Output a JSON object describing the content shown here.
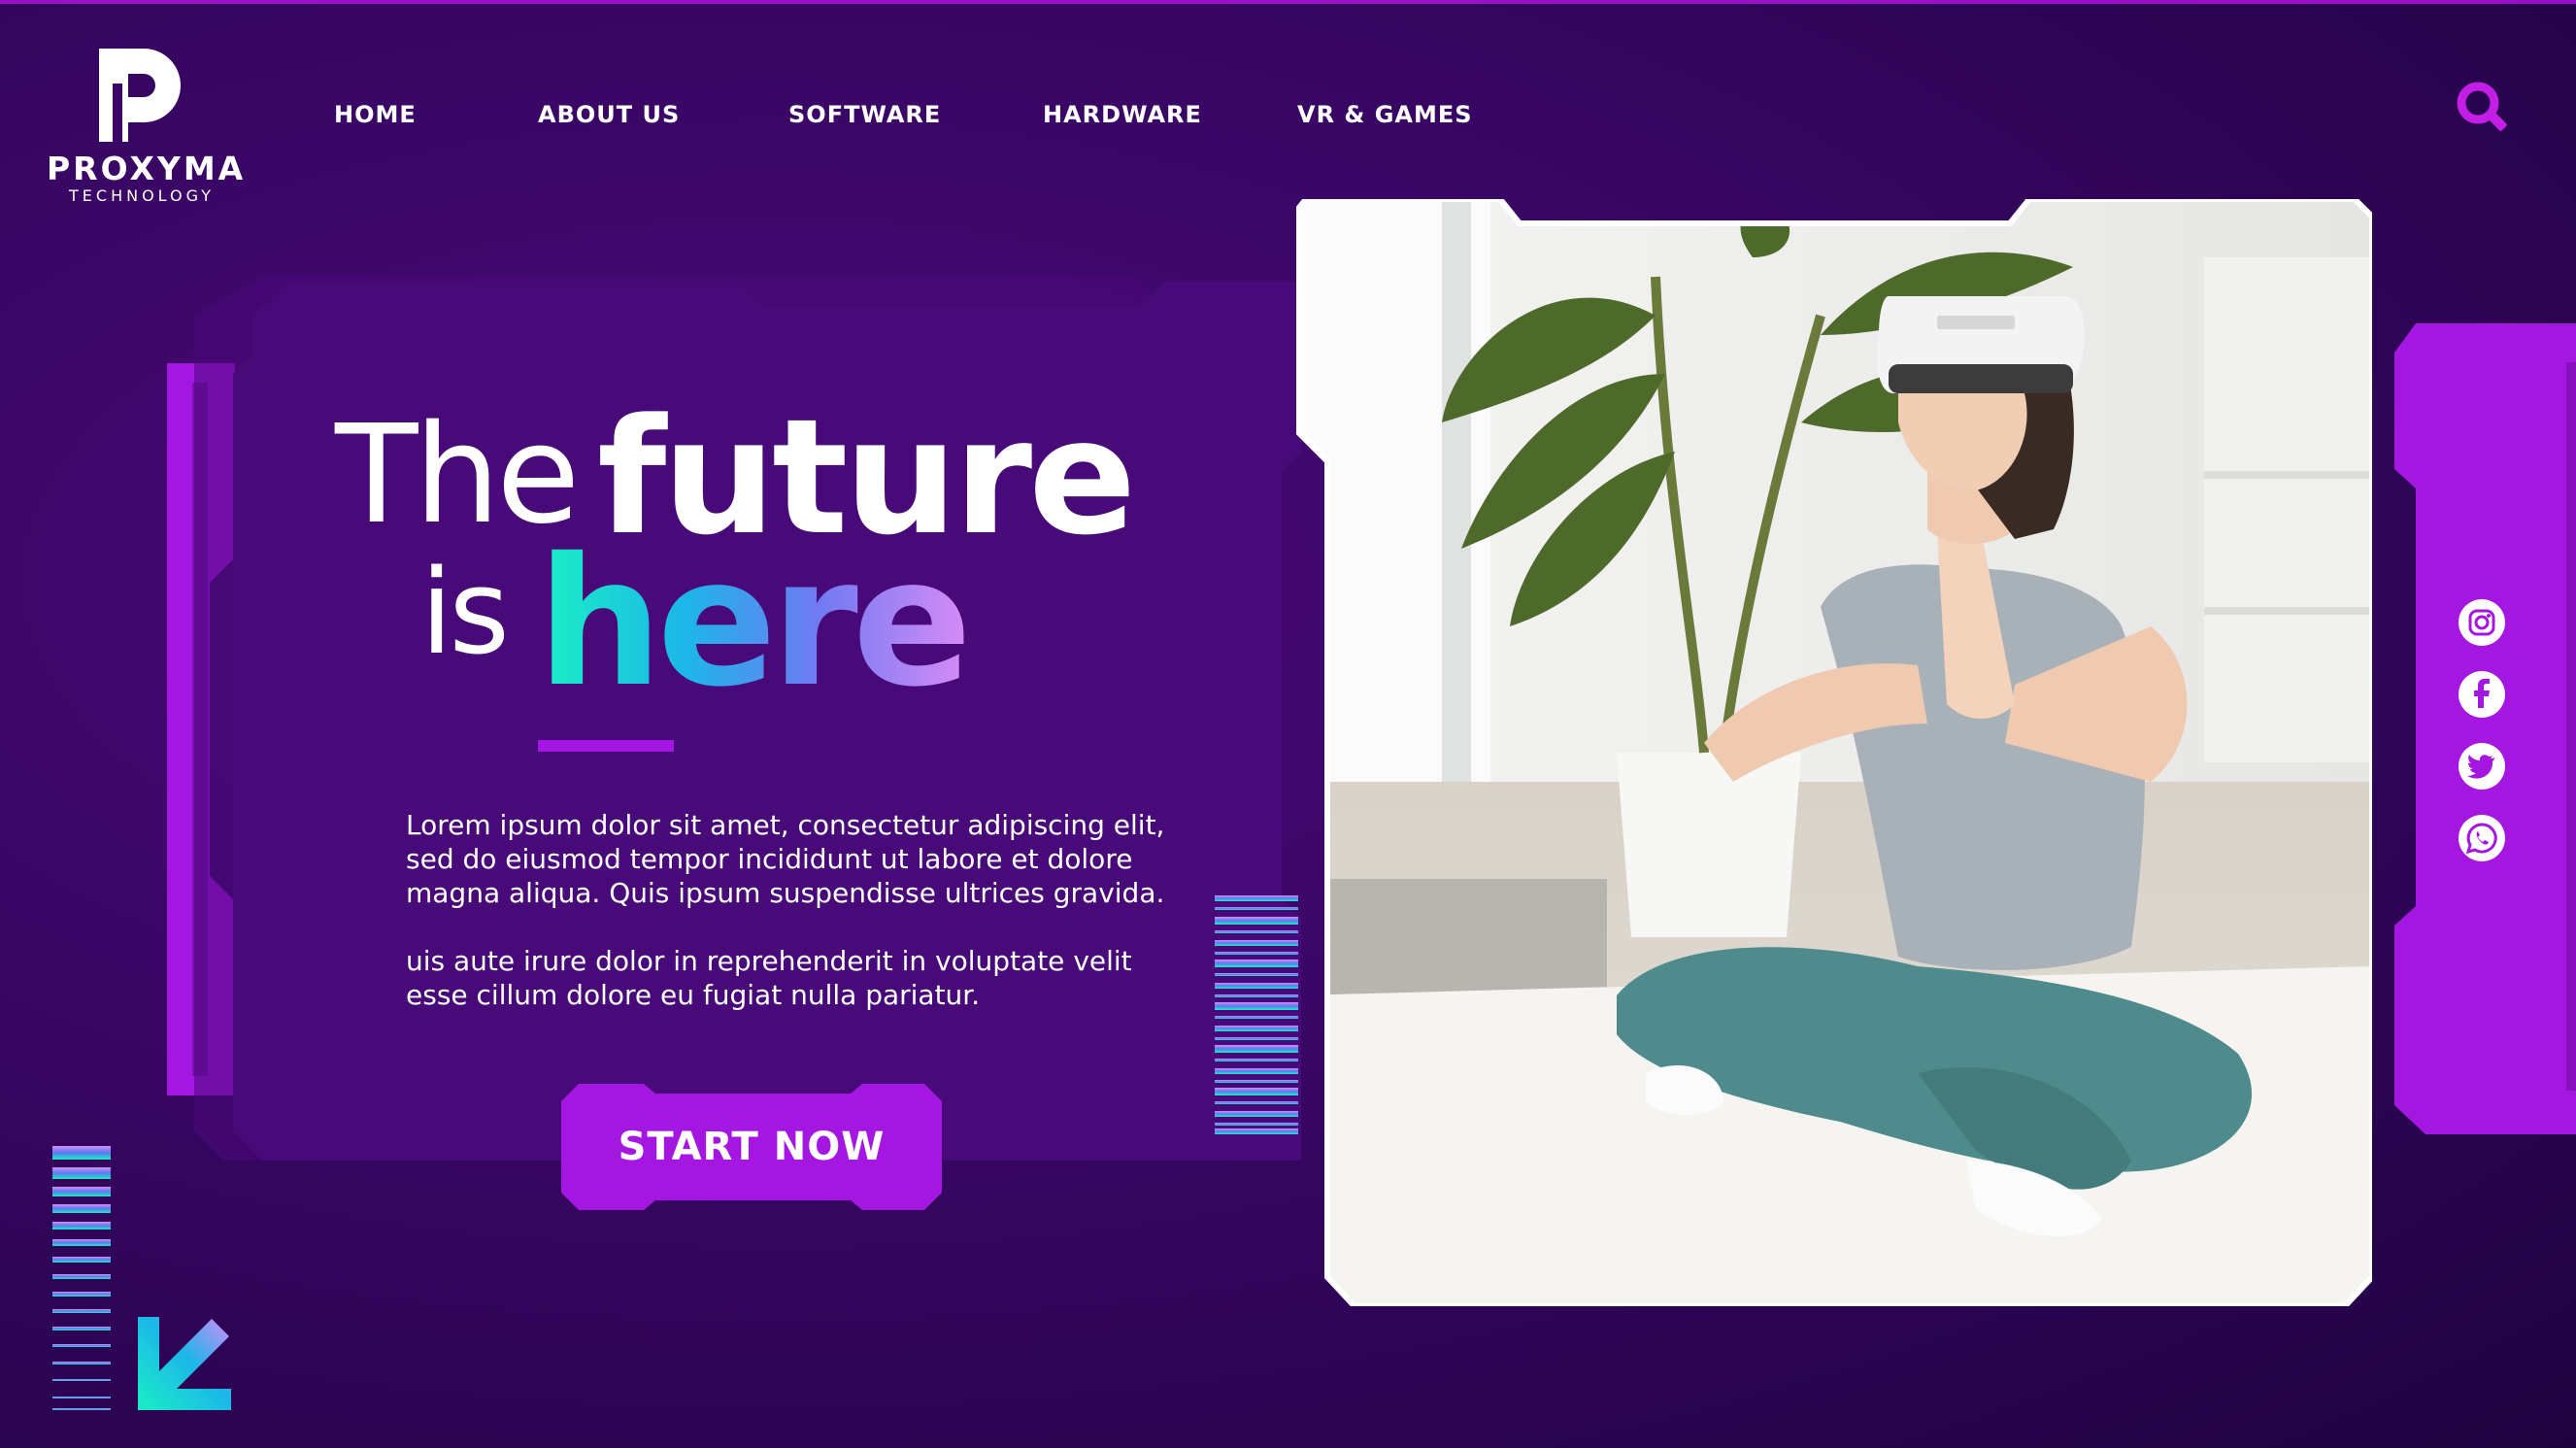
{
  "brand": {
    "name": "PROXYMA",
    "tagline": "TECHNOLOGY"
  },
  "nav": {
    "items": [
      {
        "label": "HOME"
      },
      {
        "label": "ABOUT US"
      },
      {
        "label": "SOFTWARE"
      },
      {
        "label": "HARDWARE"
      },
      {
        "label": "VR & GAMES"
      }
    ],
    "search_icon": "search-icon"
  },
  "hero": {
    "headline_word1": "The",
    "headline_word2": "future",
    "headline_word3": "is",
    "headline_word4": "here",
    "paragraph1": "Lorem ipsum dolor sit amet, consectetur adipiscing elit,\nsed do eiusmod tempor incididunt ut labore et dolore\nmagna aliqua. Quis ipsum suspendisse ultrices gravida.",
    "paragraph2": "uis aute irure dolor in reprehenderit in voluptate velit\nesse cillum dolore eu fugiat nulla pariatur.",
    "cta_label": "START NOW"
  },
  "social": {
    "icons": [
      "instagram-icon",
      "facebook-icon",
      "twitter-icon",
      "whatsapp-icon"
    ]
  },
  "colors": {
    "background": "#3a0766",
    "panel": "#4a0a7a",
    "accent_purple": "#a417e0",
    "gradient_start": "#19f0c4",
    "gradient_mid": "#1db6ea",
    "gradient_end": "#d58bf6"
  }
}
